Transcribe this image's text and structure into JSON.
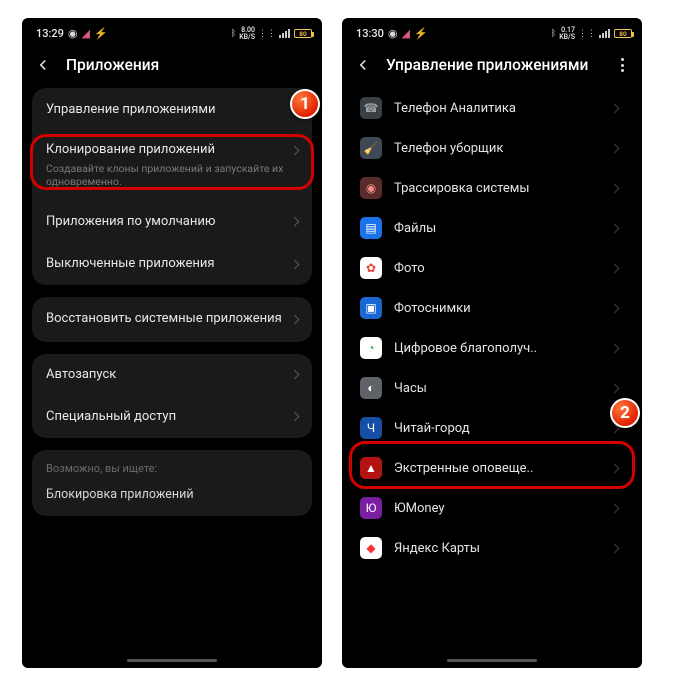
{
  "badges": {
    "one": "1",
    "two": "2"
  },
  "screen1": {
    "status": {
      "time": "13:29",
      "speed": "8.00",
      "speed_unit": "KB/S",
      "batt": "80"
    },
    "header": "Приложения",
    "groups": [
      {
        "rows": [
          {
            "label": "Управление приложениями"
          },
          {
            "label": "Клонирование приложений",
            "sub": "Создавайте клоны приложений и запускайте их одновременно."
          },
          {
            "label": "Приложения по умолчанию"
          },
          {
            "label": "Выключенные приложения"
          }
        ]
      },
      {
        "rows": [
          {
            "label": "Восстановить системные приложения"
          }
        ]
      },
      {
        "rows": [
          {
            "label": "Автозапуск"
          },
          {
            "label": "Специальный доступ"
          }
        ]
      }
    ],
    "hint_title": "Возможно, вы ищете:",
    "hint_link": "Блокировка приложений"
  },
  "screen2": {
    "status": {
      "time": "13:30",
      "speed": "0.17",
      "speed_unit": "KB/S",
      "batt": "80"
    },
    "header": "Управление приложениями",
    "apps": [
      {
        "name": "Телефон Аналитика",
        "icon_bg": "#3a3f44",
        "glyph": "☎",
        "gcolor": "#9aa0a6"
      },
      {
        "name": "Телефон уборщик",
        "icon_bg": "#3e4955",
        "glyph": "🧹",
        "gcolor": "#fff"
      },
      {
        "name": "Трассировка системы",
        "icon_bg": "#5a2b2b",
        "glyph": "◉",
        "gcolor": "#f28b82"
      },
      {
        "name": "Файлы",
        "icon_bg": "#1a73e8",
        "glyph": "▤",
        "gcolor": "#fff"
      },
      {
        "name": "Фото",
        "icon_bg": "#ffffff",
        "glyph": "✿",
        "gcolor": "#ea4335"
      },
      {
        "name": "Фотоснимки",
        "icon_bg": "#1967d2",
        "glyph": "▣",
        "gcolor": "#fff"
      },
      {
        "name": "Цифровое благополуч..",
        "icon_bg": "#ffffff",
        "glyph": "◔",
        "gcolor": "#34a853"
      },
      {
        "name": "Часы",
        "icon_bg": "#5f6368",
        "glyph": "◐",
        "gcolor": "#fff"
      },
      {
        "name": "Читай-город",
        "icon_bg": "#174ea6",
        "glyph": "Ч",
        "gcolor": "#fff"
      },
      {
        "name": "Экстренные оповеще..",
        "icon_bg": "#b31412",
        "glyph": "▲",
        "gcolor": "#fff"
      },
      {
        "name": "ЮMoney",
        "icon_bg": "#7b1fa2",
        "glyph": "Ю",
        "gcolor": "#fff"
      },
      {
        "name": "Яндекс Карты",
        "icon_bg": "#ffffff",
        "glyph": "◆",
        "gcolor": "#ff3333"
      }
    ]
  }
}
